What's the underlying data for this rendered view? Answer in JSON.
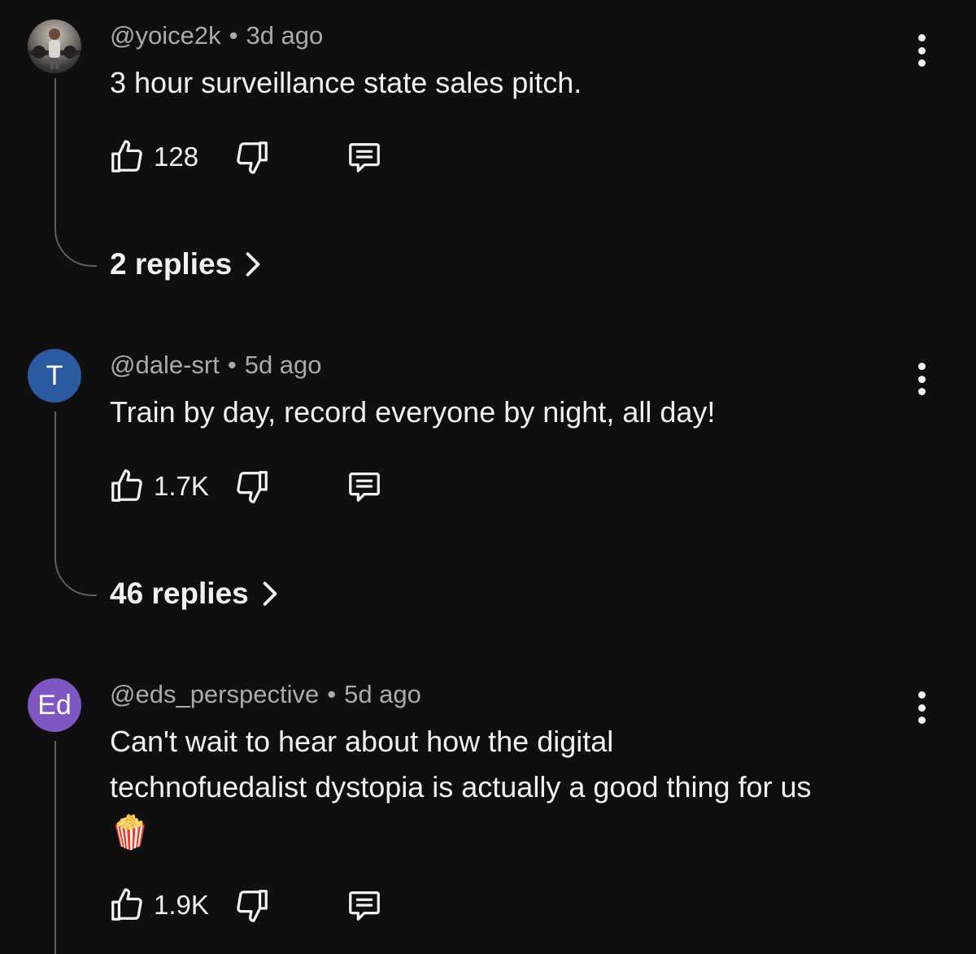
{
  "comments": [
    {
      "handle": "@yoice2k",
      "time": "3d ago",
      "avatar_type": "photo",
      "avatar_letter": "",
      "avatar_color": "",
      "text": "3 hour surveillance state sales pitch.",
      "likes": "128",
      "replies": "2 replies"
    },
    {
      "handle": "@dale-srt",
      "time": "5d ago",
      "avatar_type": "letter",
      "avatar_letter": "T",
      "avatar_color": "#2b5aa0",
      "text": "Train by day, record everyone by night, all day!",
      "likes": "1.7K",
      "replies": "46 replies"
    },
    {
      "handle": "@eds_perspective",
      "time": "5d ago",
      "avatar_type": "letter",
      "avatar_letter": "Ed",
      "avatar_color": "#7e57c2",
      "text_line1": "Can't wait to hear about how the digital",
      "text_line2": "technofuedalist dystopia is actually a good thing for us",
      "emoji": "🍿",
      "likes": "1.9K"
    }
  ],
  "separator": "•",
  "icons": {
    "like": "thumbs-up-icon",
    "dislike": "thumbs-down-icon",
    "reply": "comment-icon",
    "more": "more-vert-icon",
    "chevron": "chevron-right-icon"
  },
  "colors": {
    "background": "#0f0f0f",
    "primary_text": "#f1f1f1",
    "secondary_text": "#aaaaaa",
    "thread_line": "#5f5f5f"
  }
}
